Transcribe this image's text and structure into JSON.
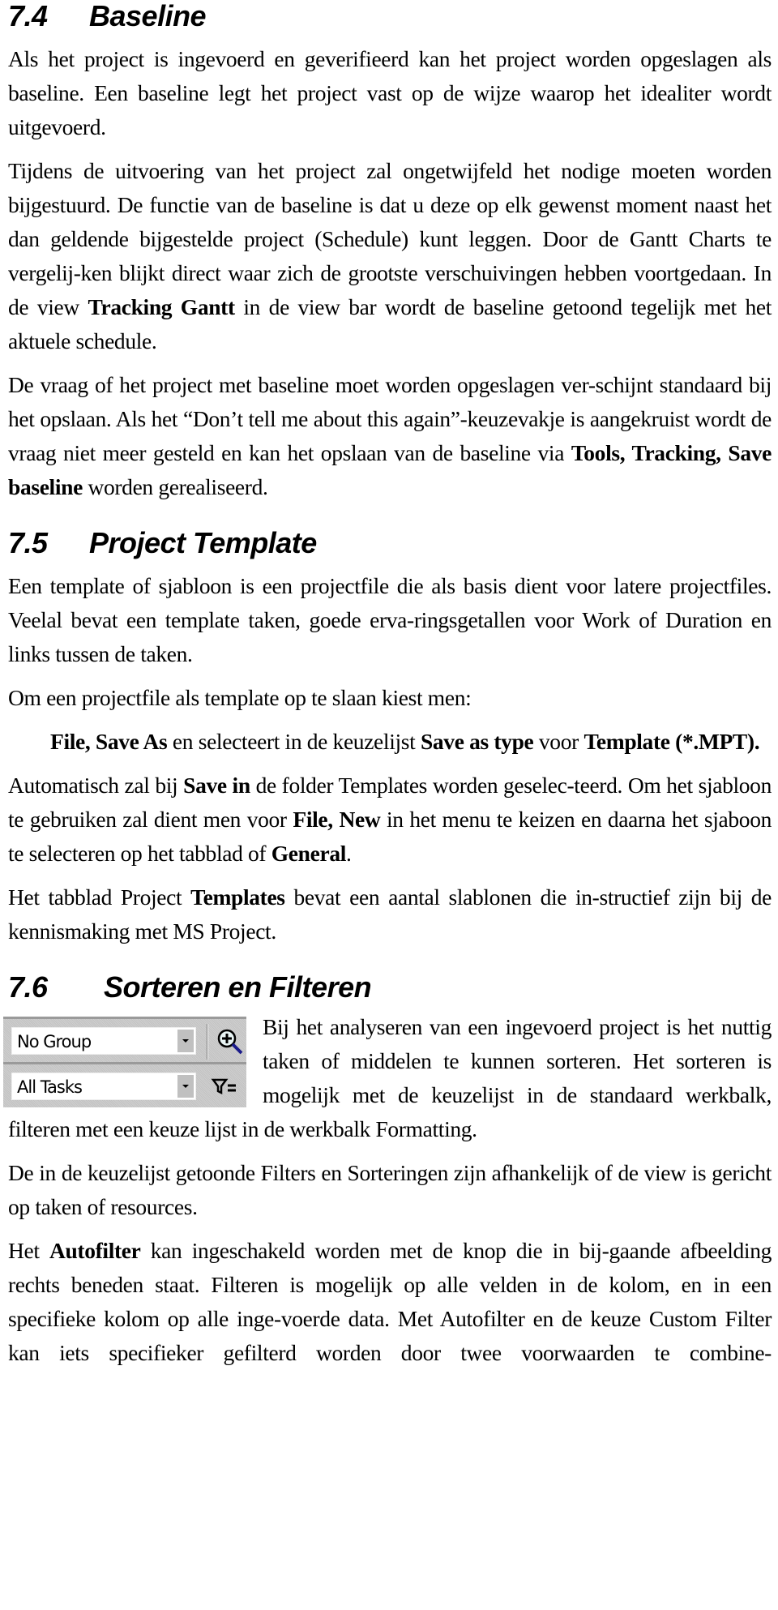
{
  "sections": {
    "s74": {
      "number": "7.4",
      "title": "Baseline",
      "p1": "Als het project is ingevoerd en geverifieerd kan het project worden opgeslagen als baseline. Een baseline legt het project vast op de wijze waarop het idealiter wordt uitgevoerd.",
      "p2_a": "Tijdens de uitvoering van het project zal ongetwijfeld het nodige moeten worden bijgestuurd. De functie van de baseline is dat u deze op elk gewenst moment naast het dan geldende bijgestelde project (Schedule) kunt leggen. Door de Gantt Charts te vergelij-ken blijkt direct waar zich de grootste verschuivingen hebben voortgedaan. In de view ",
      "p2_b": "Tracking Gantt",
      "p2_c": " in de view bar wordt de baseline getoond tegelijk met het aktuele schedule.",
      "p3_a": "De vraag of het project met baseline moet worden opgeslagen ver-schijnt standaard bij het opslaan. Als het “Don’t tell me about this again”-keuzevakje is aangekruist wordt de vraag niet meer gesteld en kan het opslaan van de baseline via ",
      "p3_b": "Tools, Tracking, Save baseline",
      "p3_c": " worden gerealiseerd."
    },
    "s75": {
      "number": "7.5",
      "title": "Project Template",
      "p1": "Een template of sjabloon is een projectfile die als basis dient voor latere projectfiles. Veelal bevat een template taken, goede erva-ringsgetallen voor Work of Duration en links tussen de taken.",
      "p2": "Om een projectfile als template op te slaan kiest men:",
      "p3_a": "File, Save As",
      "p3_b": " en selecteert in de keuzelijst ",
      "p3_c": "Save as type",
      "p3_d": " voor ",
      "p3_e": "Template (*.MPT).",
      "p4_a": "Automatisch zal bij ",
      "p4_b": "Save in",
      "p4_c": " de folder Templates worden geselec-teerd. Om het sjabloon te gebruiken zal dient men voor ",
      "p4_d": "File, New",
      "p4_e": " in het menu te keizen en daarna het sjaboon te selecteren op het tabblad of ",
      "p4_f": "General",
      "p4_g": ".",
      "p5_a": "Het tabblad Project ",
      "p5_b": "Templates",
      "p5_c": " bevat een aantal slablonen die in-structief zijn bij de kennismaking met MS Project."
    },
    "s76": {
      "number": "7.6",
      "title": "Sorteren en Filteren",
      "toolbar": {
        "group_combo_value": "No Group",
        "group_icon": "zoom-in-magnifier-icon",
        "filter_combo_value": "All Tasks",
        "filter_icon": "autofilter-icon"
      },
      "p1": "Bij het analyseren van een ingevoerd project is het nuttig taken of middelen te kunnen sorteren. Het sorteren is mogelijk met de keuzelijst in de standaard werkbalk, filteren met een keuze lijst in de werkbalk Formatting.",
      "p2": "De in de keuzelijst getoonde Filters en Sorteringen zijn afhankelijk of de view is gericht op taken of resources.",
      "p3_a": "Het ",
      "p3_b": "Autofilter",
      "p3_c": " kan ingeschakeld worden met de knop die in bij-gaande afbeelding rechts beneden staat. Filteren is mogelijk op alle velden in de kolom, en in een specifieke kolom op alle inge-voerde data. Met Autofilter en de keuze Custom Filter kan iets specifieker gefilterd worden door twee voorwaarden te combine-"
    }
  }
}
